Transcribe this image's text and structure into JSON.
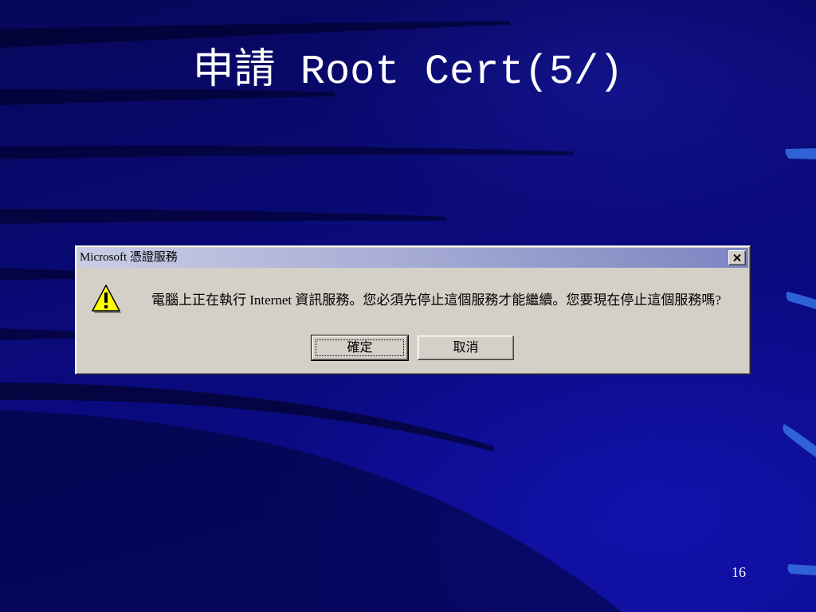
{
  "slide": {
    "title": "申請 Root Cert(5/)",
    "page_number": "16"
  },
  "dialog": {
    "title": "Microsoft 憑證服務",
    "close_icon": "close-icon",
    "message_icon": "warning-icon",
    "message": "電腦上正在執行 Internet 資訊服務。您必須先停止這個服務才能繼續。您要現在停止這個服務嗎?",
    "buttons": {
      "ok": "確定",
      "cancel": "取消"
    }
  },
  "colors": {
    "slide_background": "#0a0a7c",
    "slide_text": "#ffffff",
    "accent_bar": "#2f62d6",
    "dialog_face": "#d4d0c8",
    "warning_yellow": "#ffff00"
  }
}
